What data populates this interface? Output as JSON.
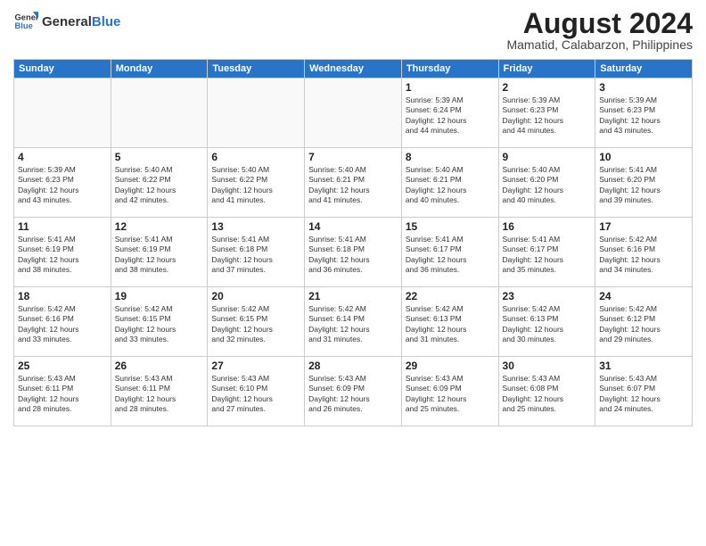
{
  "header": {
    "logo_general": "General",
    "logo_blue": "Blue",
    "month_title": "August 2024",
    "location": "Mamatid, Calabarzon, Philippines"
  },
  "days_of_week": [
    "Sunday",
    "Monday",
    "Tuesday",
    "Wednesday",
    "Thursday",
    "Friday",
    "Saturday"
  ],
  "weeks": [
    [
      {
        "day": "",
        "info": ""
      },
      {
        "day": "",
        "info": ""
      },
      {
        "day": "",
        "info": ""
      },
      {
        "day": "",
        "info": ""
      },
      {
        "day": "1",
        "info": "Sunrise: 5:39 AM\nSunset: 6:24 PM\nDaylight: 12 hours\nand 44 minutes."
      },
      {
        "day": "2",
        "info": "Sunrise: 5:39 AM\nSunset: 6:23 PM\nDaylight: 12 hours\nand 44 minutes."
      },
      {
        "day": "3",
        "info": "Sunrise: 5:39 AM\nSunset: 6:23 PM\nDaylight: 12 hours\nand 43 minutes."
      }
    ],
    [
      {
        "day": "4",
        "info": "Sunrise: 5:39 AM\nSunset: 6:23 PM\nDaylight: 12 hours\nand 43 minutes."
      },
      {
        "day": "5",
        "info": "Sunrise: 5:40 AM\nSunset: 6:22 PM\nDaylight: 12 hours\nand 42 minutes."
      },
      {
        "day": "6",
        "info": "Sunrise: 5:40 AM\nSunset: 6:22 PM\nDaylight: 12 hours\nand 41 minutes."
      },
      {
        "day": "7",
        "info": "Sunrise: 5:40 AM\nSunset: 6:21 PM\nDaylight: 12 hours\nand 41 minutes."
      },
      {
        "day": "8",
        "info": "Sunrise: 5:40 AM\nSunset: 6:21 PM\nDaylight: 12 hours\nand 40 minutes."
      },
      {
        "day": "9",
        "info": "Sunrise: 5:40 AM\nSunset: 6:20 PM\nDaylight: 12 hours\nand 40 minutes."
      },
      {
        "day": "10",
        "info": "Sunrise: 5:41 AM\nSunset: 6:20 PM\nDaylight: 12 hours\nand 39 minutes."
      }
    ],
    [
      {
        "day": "11",
        "info": "Sunrise: 5:41 AM\nSunset: 6:19 PM\nDaylight: 12 hours\nand 38 minutes."
      },
      {
        "day": "12",
        "info": "Sunrise: 5:41 AM\nSunset: 6:19 PM\nDaylight: 12 hours\nand 38 minutes."
      },
      {
        "day": "13",
        "info": "Sunrise: 5:41 AM\nSunset: 6:18 PM\nDaylight: 12 hours\nand 37 minutes."
      },
      {
        "day": "14",
        "info": "Sunrise: 5:41 AM\nSunset: 6:18 PM\nDaylight: 12 hours\nand 36 minutes."
      },
      {
        "day": "15",
        "info": "Sunrise: 5:41 AM\nSunset: 6:17 PM\nDaylight: 12 hours\nand 36 minutes."
      },
      {
        "day": "16",
        "info": "Sunrise: 5:41 AM\nSunset: 6:17 PM\nDaylight: 12 hours\nand 35 minutes."
      },
      {
        "day": "17",
        "info": "Sunrise: 5:42 AM\nSunset: 6:16 PM\nDaylight: 12 hours\nand 34 minutes."
      }
    ],
    [
      {
        "day": "18",
        "info": "Sunrise: 5:42 AM\nSunset: 6:16 PM\nDaylight: 12 hours\nand 33 minutes."
      },
      {
        "day": "19",
        "info": "Sunrise: 5:42 AM\nSunset: 6:15 PM\nDaylight: 12 hours\nand 33 minutes."
      },
      {
        "day": "20",
        "info": "Sunrise: 5:42 AM\nSunset: 6:15 PM\nDaylight: 12 hours\nand 32 minutes."
      },
      {
        "day": "21",
        "info": "Sunrise: 5:42 AM\nSunset: 6:14 PM\nDaylight: 12 hours\nand 31 minutes."
      },
      {
        "day": "22",
        "info": "Sunrise: 5:42 AM\nSunset: 6:13 PM\nDaylight: 12 hours\nand 31 minutes."
      },
      {
        "day": "23",
        "info": "Sunrise: 5:42 AM\nSunset: 6:13 PM\nDaylight: 12 hours\nand 30 minutes."
      },
      {
        "day": "24",
        "info": "Sunrise: 5:42 AM\nSunset: 6:12 PM\nDaylight: 12 hours\nand 29 minutes."
      }
    ],
    [
      {
        "day": "25",
        "info": "Sunrise: 5:43 AM\nSunset: 6:11 PM\nDaylight: 12 hours\nand 28 minutes."
      },
      {
        "day": "26",
        "info": "Sunrise: 5:43 AM\nSunset: 6:11 PM\nDaylight: 12 hours\nand 28 minutes."
      },
      {
        "day": "27",
        "info": "Sunrise: 5:43 AM\nSunset: 6:10 PM\nDaylight: 12 hours\nand 27 minutes."
      },
      {
        "day": "28",
        "info": "Sunrise: 5:43 AM\nSunset: 6:09 PM\nDaylight: 12 hours\nand 26 minutes."
      },
      {
        "day": "29",
        "info": "Sunrise: 5:43 AM\nSunset: 6:09 PM\nDaylight: 12 hours\nand 25 minutes."
      },
      {
        "day": "30",
        "info": "Sunrise: 5:43 AM\nSunset: 6:08 PM\nDaylight: 12 hours\nand 25 minutes."
      },
      {
        "day": "31",
        "info": "Sunrise: 5:43 AM\nSunset: 6:07 PM\nDaylight: 12 hours\nand 24 minutes."
      }
    ]
  ]
}
